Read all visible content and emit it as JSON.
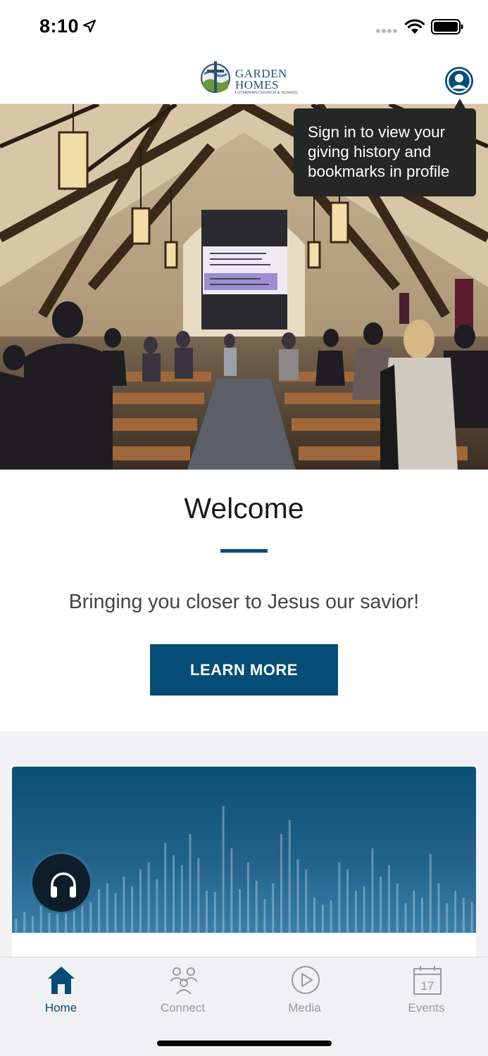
{
  "status_bar": {
    "time": "8:10",
    "icons": [
      "location-arrow-icon",
      "signal-dots-icon",
      "wifi-icon",
      "battery-icon"
    ]
  },
  "header": {
    "logo": {
      "line1": "GARDEN",
      "line2": "HOMES",
      "line3": "LUTHERAN CHURCH & SCHOOL"
    },
    "profile_icon": "profile-icon"
  },
  "tooltip": {
    "text": "Sign in to view your giving history and bookmarks in profile"
  },
  "welcome": {
    "title": "Welcome",
    "subtitle": "Bringing you closer to Jesus our savior!",
    "button_label": "LEARN MORE"
  },
  "audio_card": {
    "icon": "headphones-icon"
  },
  "tabbar": {
    "tabs": [
      {
        "label": "Home",
        "icon": "home-icon",
        "active": true
      },
      {
        "label": "Connect",
        "icon": "people-icon",
        "active": false
      },
      {
        "label": "Media",
        "icon": "play-icon",
        "active": false
      },
      {
        "label": "Events",
        "icon": "calendar-icon",
        "active": false
      }
    ],
    "calendar_day": "17"
  },
  "colors": {
    "brand": "#054d77",
    "tooltip_bg": "#262626",
    "tab_inactive": "#9a9a9e"
  }
}
